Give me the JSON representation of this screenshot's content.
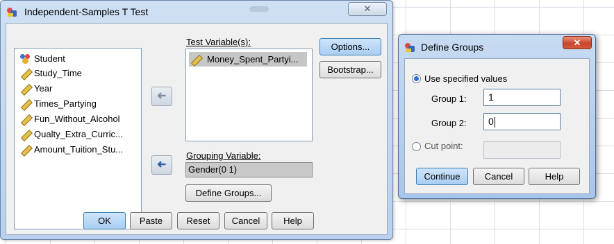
{
  "main_dialog": {
    "title": "Independent-Samples T Test",
    "close_glyph": "✕",
    "variables": [
      {
        "name": "Student",
        "icon": "nominal-variable-icon"
      },
      {
        "name": "Study_Time",
        "icon": "scale-variable-icon"
      },
      {
        "name": "Year",
        "icon": "scale-variable-icon"
      },
      {
        "name": "Times_Partying",
        "icon": "scale-variable-icon"
      },
      {
        "name": "Fun_Without_Alcohol",
        "icon": "scale-variable-icon"
      },
      {
        "name": "Qualty_Extra_Curric...",
        "icon": "scale-variable-icon"
      },
      {
        "name": "Amount_Tuition_Stu...",
        "icon": "scale-variable-icon"
      }
    ],
    "test_variables_label": "Test Variable(s):",
    "test_variables": [
      {
        "name": "Money_Spent_Partyi...",
        "icon": "scale-variable-icon"
      }
    ],
    "grouping_variable_label": "Grouping Variable:",
    "grouping_variable": "Gender(0 1)",
    "move_arrow_glyph": "➜",
    "buttons": {
      "options": "Options...",
      "bootstrap": "Bootstrap...",
      "define_groups": "Define Groups...",
      "ok": "OK",
      "paste": "Paste",
      "reset": "Reset",
      "cancel": "Cancel",
      "help": "Help"
    }
  },
  "define_groups": {
    "title": "Define Groups",
    "close_glyph": "✕",
    "use_specified_label": "Use specified values",
    "use_specified_selected": true,
    "group1_label": "Group 1:",
    "group1_value": "1",
    "group2_label": "Group 2:",
    "group2_value": "0",
    "cut_point_label": "Cut point:",
    "cut_point_selected": false,
    "cut_point_value": "",
    "buttons": {
      "continue": "Continue",
      "cancel": "Cancel",
      "help": "Help"
    }
  },
  "colors": {
    "title_bar": "#cfe0f3",
    "accent_button": "#a9cdf2",
    "close_red": "#c9452c",
    "readonly_field": "#c9c9c9"
  }
}
